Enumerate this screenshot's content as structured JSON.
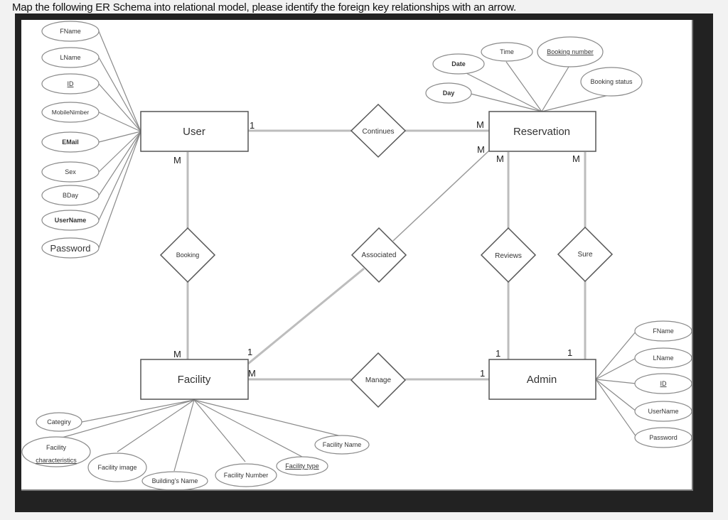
{
  "question": "Map the following ER Schema into relational model, please identify the foreign key relationships with an arrow.",
  "entities": {
    "user": "User",
    "reservation": "Reservation",
    "facility": "Facility",
    "admin": "Admin"
  },
  "relationships": {
    "continues": "Continues",
    "booking": "Booking",
    "associated": "Associated",
    "reviews": "Reviews",
    "sure": "Sure",
    "manage": "Manage"
  },
  "cardinalities": {
    "user_continues": "1",
    "reservation_continues": "M",
    "user_booking": "M",
    "facility_booking": "M",
    "reservation_associated": "M",
    "facility_associated": "1",
    "reservation_reviews": "M",
    "admin_reviews": "1",
    "reservation_sure": "M",
    "admin_sure": "1",
    "facility_manage": "M",
    "admin_manage": "1"
  },
  "attributes": {
    "user": [
      "FName",
      "LName",
      "ID",
      "MobileNimber",
      "EMail",
      "Sex",
      "BDay",
      "UserName",
      "Password"
    ],
    "reservation": [
      "Time",
      "Booking number",
      "Date",
      "Day",
      "Booking status"
    ],
    "admin": [
      "FName",
      "LName",
      "ID",
      "UserName",
      "Password"
    ],
    "facility": [
      "Categiry",
      "Facility",
      "characteristics",
      "Facility image",
      "Building's Name",
      "Facility Number",
      "Facility type",
      "Facility Name"
    ]
  }
}
